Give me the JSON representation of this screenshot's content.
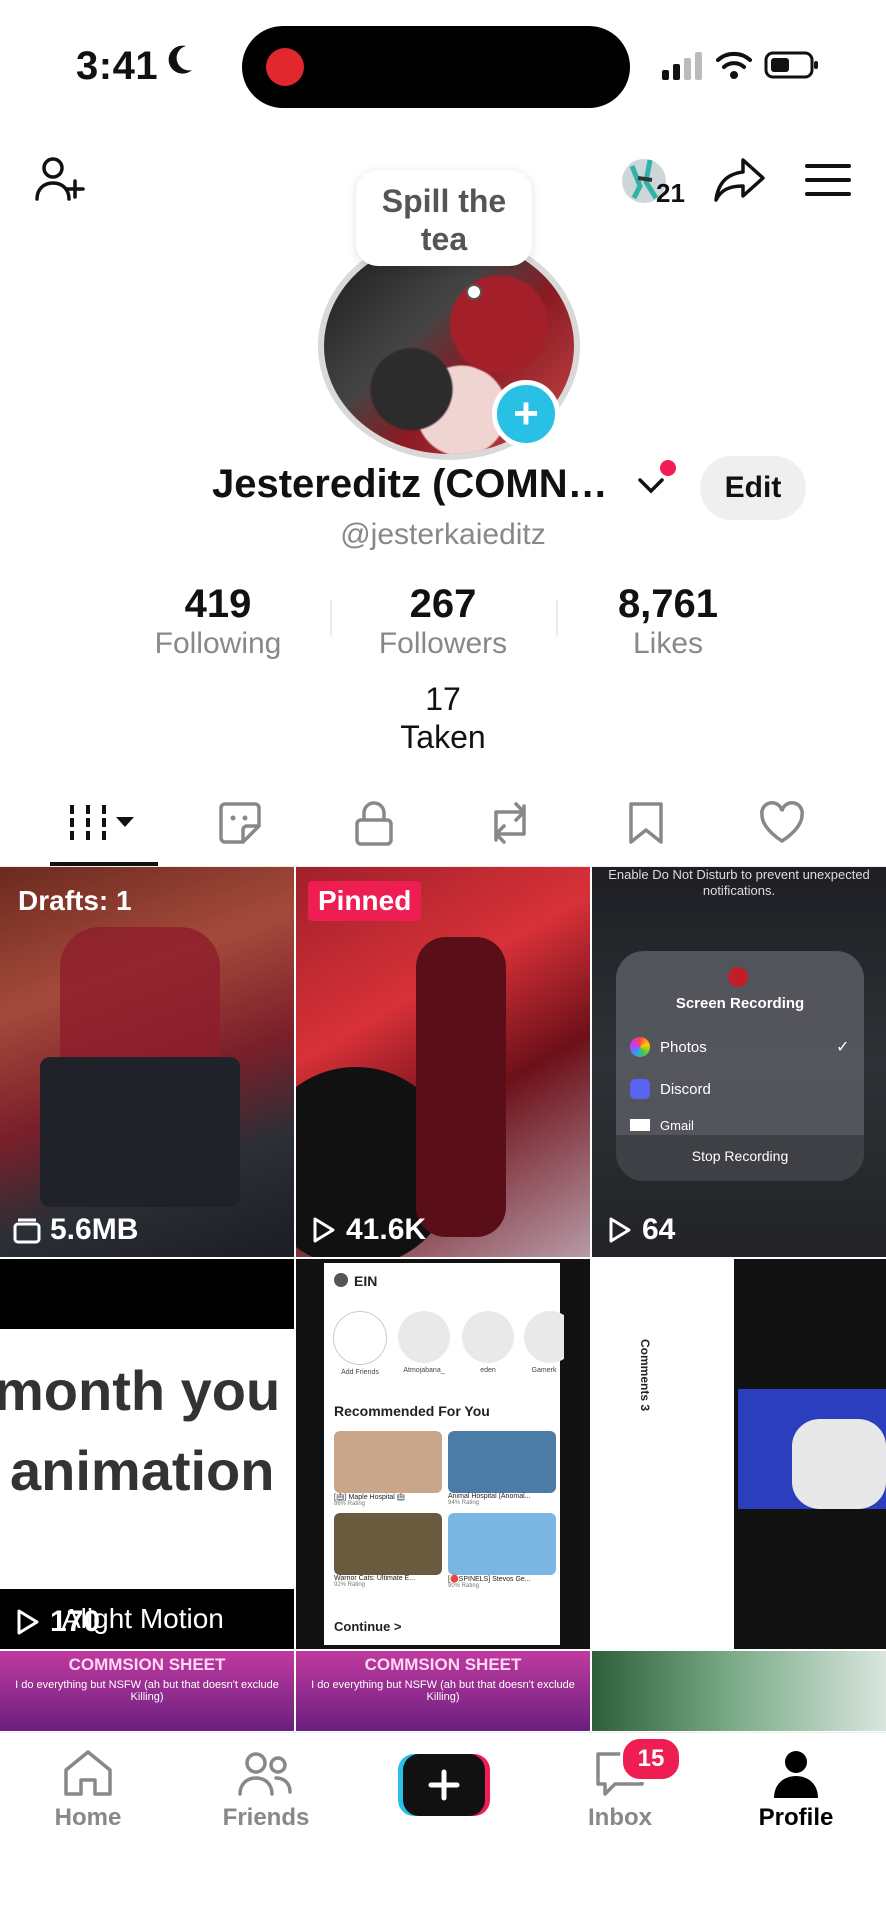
{
  "status_bar": {
    "time": "3:41",
    "moon_icon": "moon-icon",
    "signal_icon": "signal-icon",
    "wifi_icon": "wifi-icon",
    "battery_icon": "battery-icon"
  },
  "top_bar": {
    "add_friend_icon": "add-user-icon",
    "bubbles_count": "21",
    "share_icon": "share-icon",
    "menu_icon": "menu-icon"
  },
  "profile": {
    "note": "Spill the tea",
    "display_name": "Jestereditz (COMN…",
    "handle": "@jesterkaieditz",
    "edit_label": "Edit",
    "stats": [
      {
        "value": "419",
        "label": "Following"
      },
      {
        "value": "267",
        "label": "Followers"
      },
      {
        "value": "8,761",
        "label": "Likes"
      }
    ],
    "taken": {
      "value": "17",
      "label": "Taken"
    }
  },
  "tabs": [
    {
      "name": "videos",
      "icon": "grid-icon",
      "active": true
    },
    {
      "name": "stickers",
      "icon": "sticker-icon"
    },
    {
      "name": "private",
      "icon": "lock-icon"
    },
    {
      "name": "reposts",
      "icon": "repost-icon"
    },
    {
      "name": "favorites",
      "icon": "bookmark-icon"
    },
    {
      "name": "liked",
      "icon": "heart-icon"
    }
  ],
  "grid": [
    {
      "badge": "Drafts: 1",
      "meta": "5.6MB",
      "meta_icon": "drafts-icon"
    },
    {
      "badge": "Pinned",
      "meta": "41.6K",
      "meta_icon": "play-icon"
    },
    {
      "meta": "64",
      "meta_icon": "play-icon",
      "overlay": {
        "dnd_text": "Enable Do Not Disturb to prevent unexpected notifications.",
        "title": "Screen Recording",
        "options": [
          "Photos",
          "Discord",
          "Gmail"
        ],
        "stop": "Stop Recording"
      }
    },
    {
      "text_line1": "month you",
      "text_line2": "animation",
      "meta": "170",
      "meta_icon": "play-icon",
      "caption": "Alight Motion"
    },
    {
      "app_title": "EIN",
      "section": "Recommended For You",
      "friends": [
        "Add Friends",
        "Atmojabana_",
        "eden",
        "Gamerk"
      ],
      "games": [
        {
          "name": "[🏥] Maple Hospital 🏥",
          "rating": "86% Rating"
        },
        {
          "name": "Animal Hospital (Anomal...",
          "rating": "94% Rating"
        },
        {
          "name": "Warrior Cats: Ultimate E...",
          "rating": "92% Rating"
        },
        {
          "name": "[🔴SPINELS] Stevos Ge...",
          "rating": "90% Rating"
        }
      ],
      "continue_label": "Continue >"
    },
    {
      "caption": "Comments 3"
    },
    {
      "title": "COMMSION SHEET",
      "subtitle": "I do everything but NSFW (ah but that doesn't exclude Killing)"
    },
    {
      "title": "COMMSION SHEET",
      "subtitle": "I do everything but NSFW (ah but that doesn't exclude Killing)"
    },
    {}
  ],
  "nav": {
    "home": "Home",
    "friends": "Friends",
    "inbox": "Inbox",
    "inbox_badge": "15",
    "profile": "Profile"
  },
  "colors": {
    "accent_pink": "#ee1d52",
    "accent_cyan": "#29c0e6"
  }
}
